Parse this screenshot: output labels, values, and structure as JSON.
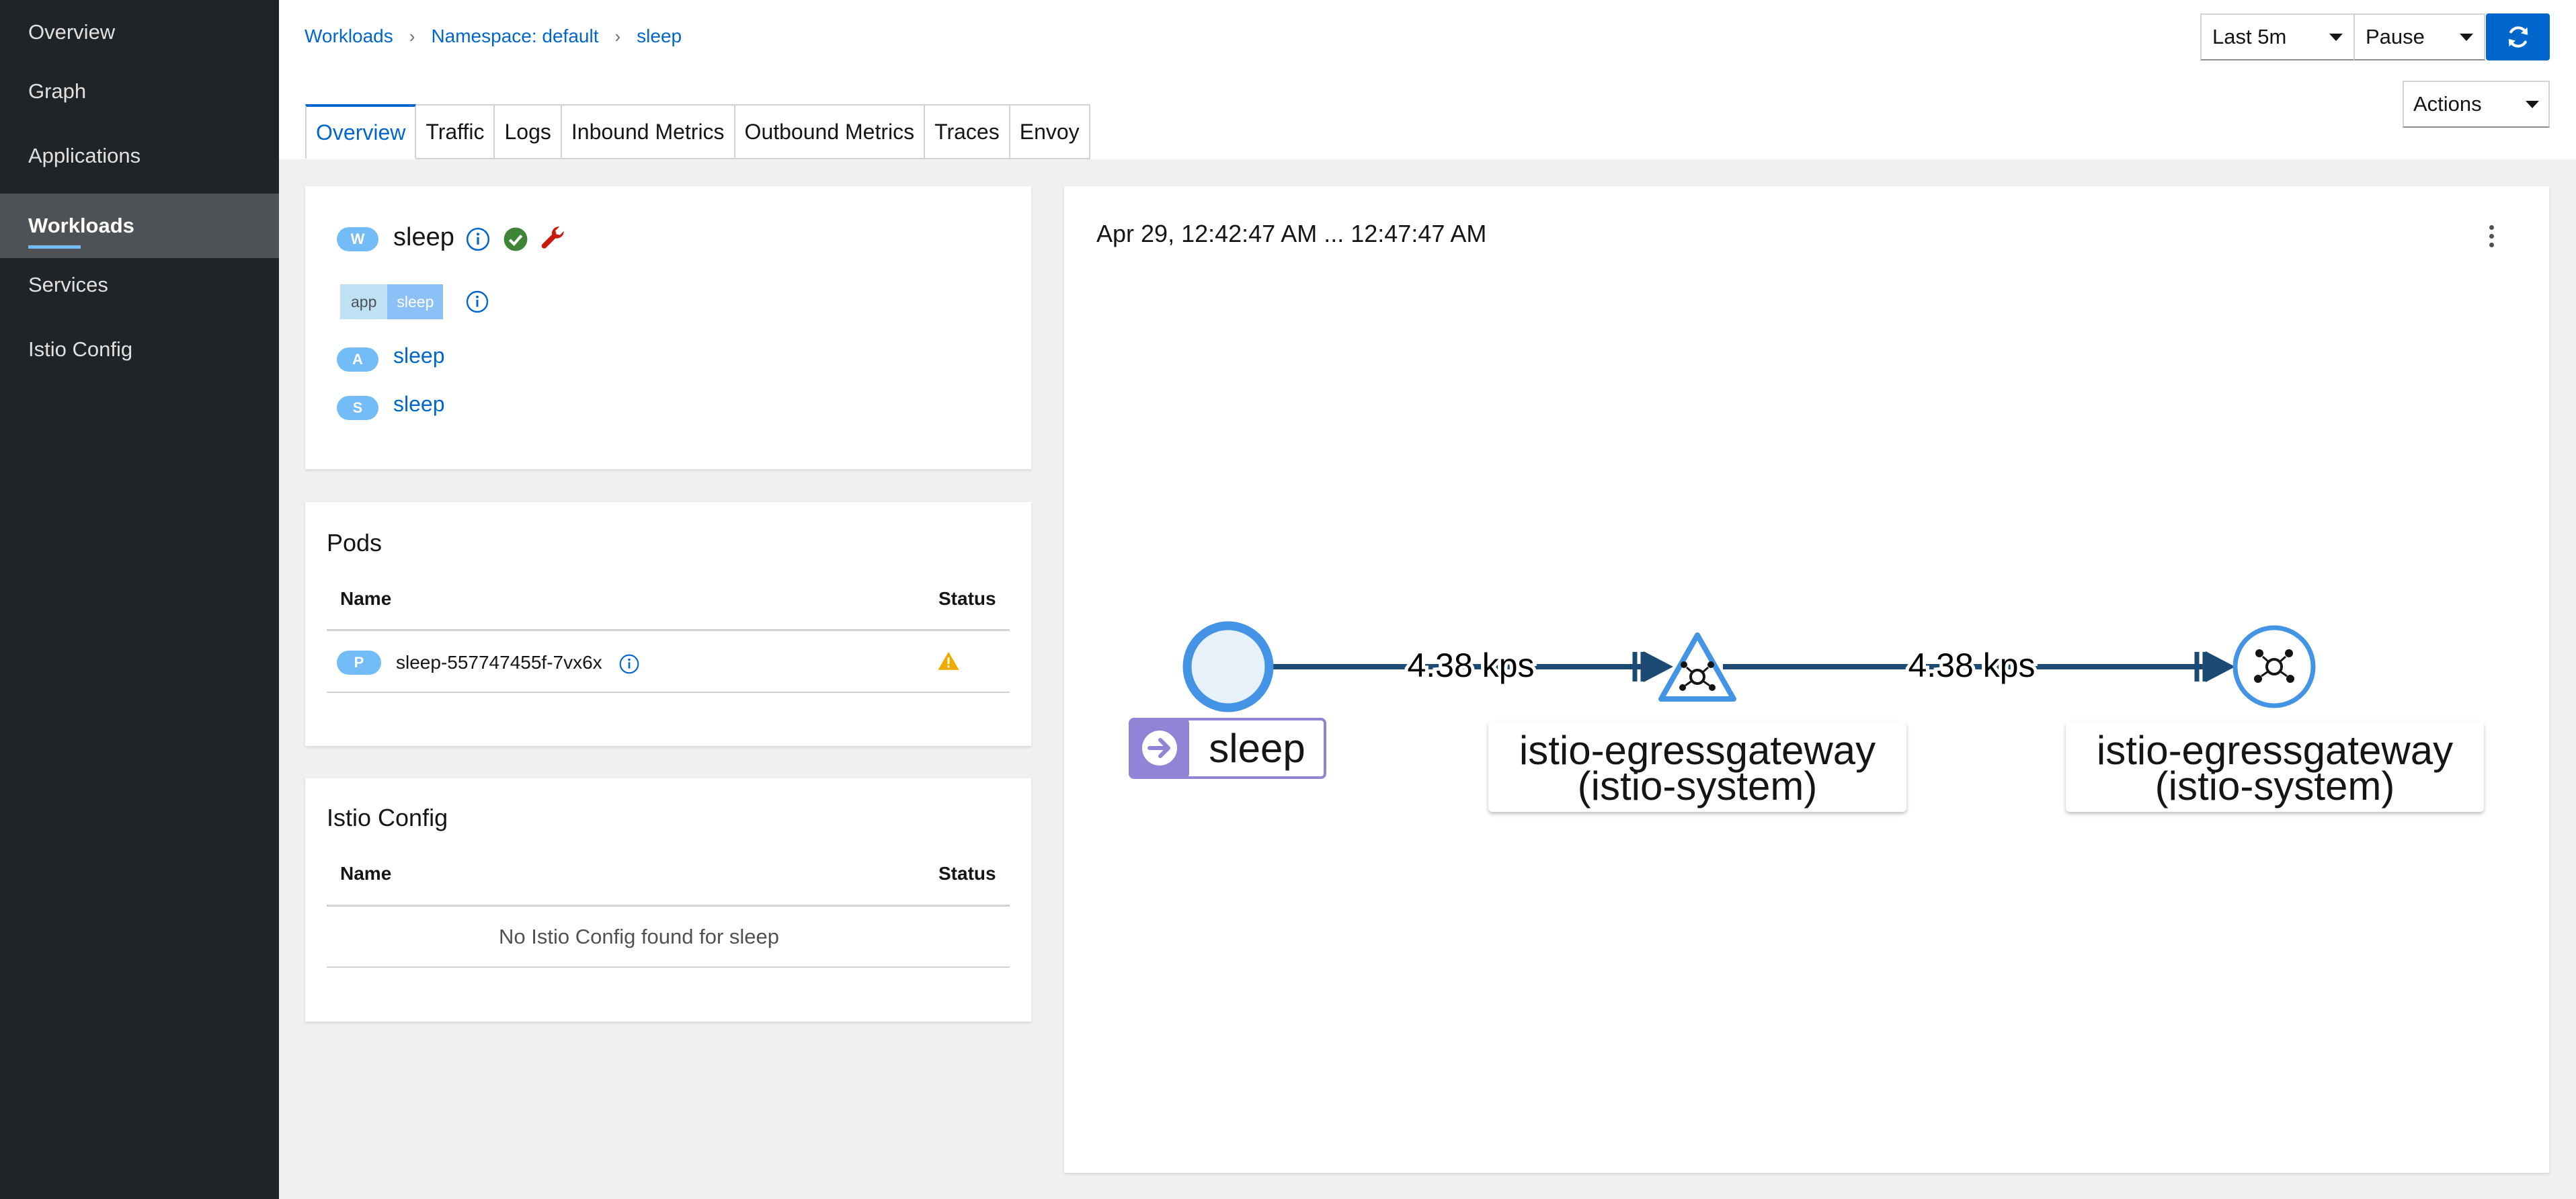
{
  "sidebar": {
    "items": [
      {
        "label": "Overview"
      },
      {
        "label": "Graph"
      },
      {
        "label": "Applications"
      },
      {
        "label": "Workloads",
        "active": true
      },
      {
        "label": "Services"
      },
      {
        "label": "Istio Config"
      }
    ]
  },
  "breadcrumb": [
    "Workloads",
    "Namespace: default",
    "sleep"
  ],
  "toolbar": {
    "duration": "Last 5m",
    "refresh_interval": "Pause",
    "actions_label": "Actions"
  },
  "tabs": [
    "Overview",
    "Traffic",
    "Logs",
    "Inbound Metrics",
    "Outbound Metrics",
    "Traces",
    "Envoy"
  ],
  "workload": {
    "type_badge": "W",
    "name": "sleep",
    "label_key": "app",
    "label_value": "sleep",
    "app_badge": "A",
    "app_link": "sleep",
    "service_badge": "S",
    "service_link": "sleep"
  },
  "pods": {
    "title": "Pods",
    "col_name": "Name",
    "col_status": "Status",
    "rows": [
      {
        "badge": "P",
        "name": "sleep-557747455f-7vx6x",
        "status": "warning"
      }
    ]
  },
  "istio_config": {
    "title": "Istio Config",
    "col_name": "Name",
    "col_status": "Status",
    "empty": "No Istio Config found for sleep"
  },
  "graph": {
    "time_range": "Apr 29, 12:42:47 AM ... 12:47:47 AM",
    "edges": [
      {
        "label": "4.38 kps"
      },
      {
        "label": "4.38 kps"
      }
    ],
    "nodes": [
      {
        "label": "sleep"
      },
      {
        "label_line1": "istio-egressgateway",
        "label_line2": "(istio-system)"
      },
      {
        "label_line1": "istio-egressgateway",
        "label_line2": "(istio-system)"
      }
    ]
  },
  "colors": {
    "sidebar_bg": "#212427",
    "link": "#0066cc",
    "badge": "#73bcf7",
    "success": "#3e8635",
    "warning": "#f0ab00",
    "wrench": "#c9190b",
    "edge": "#1b4a72",
    "node_ring": "#4394e5",
    "app_box": "#8f84d6"
  }
}
